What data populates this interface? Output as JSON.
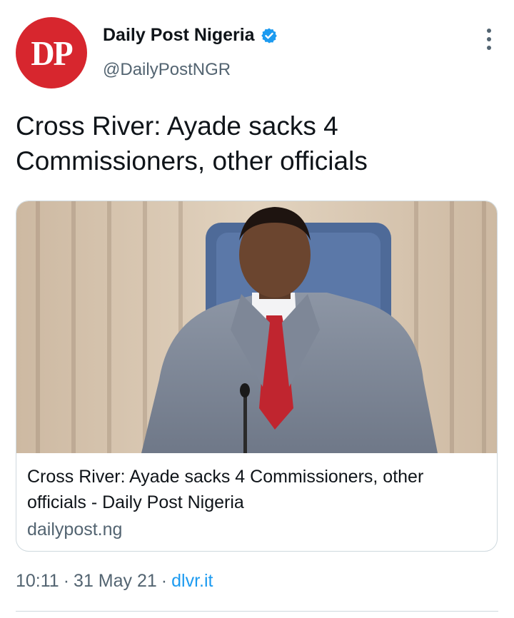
{
  "author": {
    "avatar_text": "DP",
    "display_name": "Daily Post Nigeria",
    "handle": "@DailyPostNGR",
    "verified": true,
    "brand_color": "#d7262e"
  },
  "tweet": {
    "text": "Cross River: Ayade sacks 4 Commissioners, other officials"
  },
  "card": {
    "image_icon": "portrait-photo",
    "title": "Cross River: Ayade sacks 4 Commissioners, other officials - Daily Post Nigeria",
    "domain": "dailypost.ng"
  },
  "meta": {
    "time": "10:11",
    "separator": "·",
    "date": "31 May 21",
    "source": "dlvr.it"
  },
  "colors": {
    "text": "#0f1419",
    "secondary": "#536471",
    "link": "#1d9bf0",
    "verified": "#1d9bf0",
    "border": "#cfd9de"
  }
}
